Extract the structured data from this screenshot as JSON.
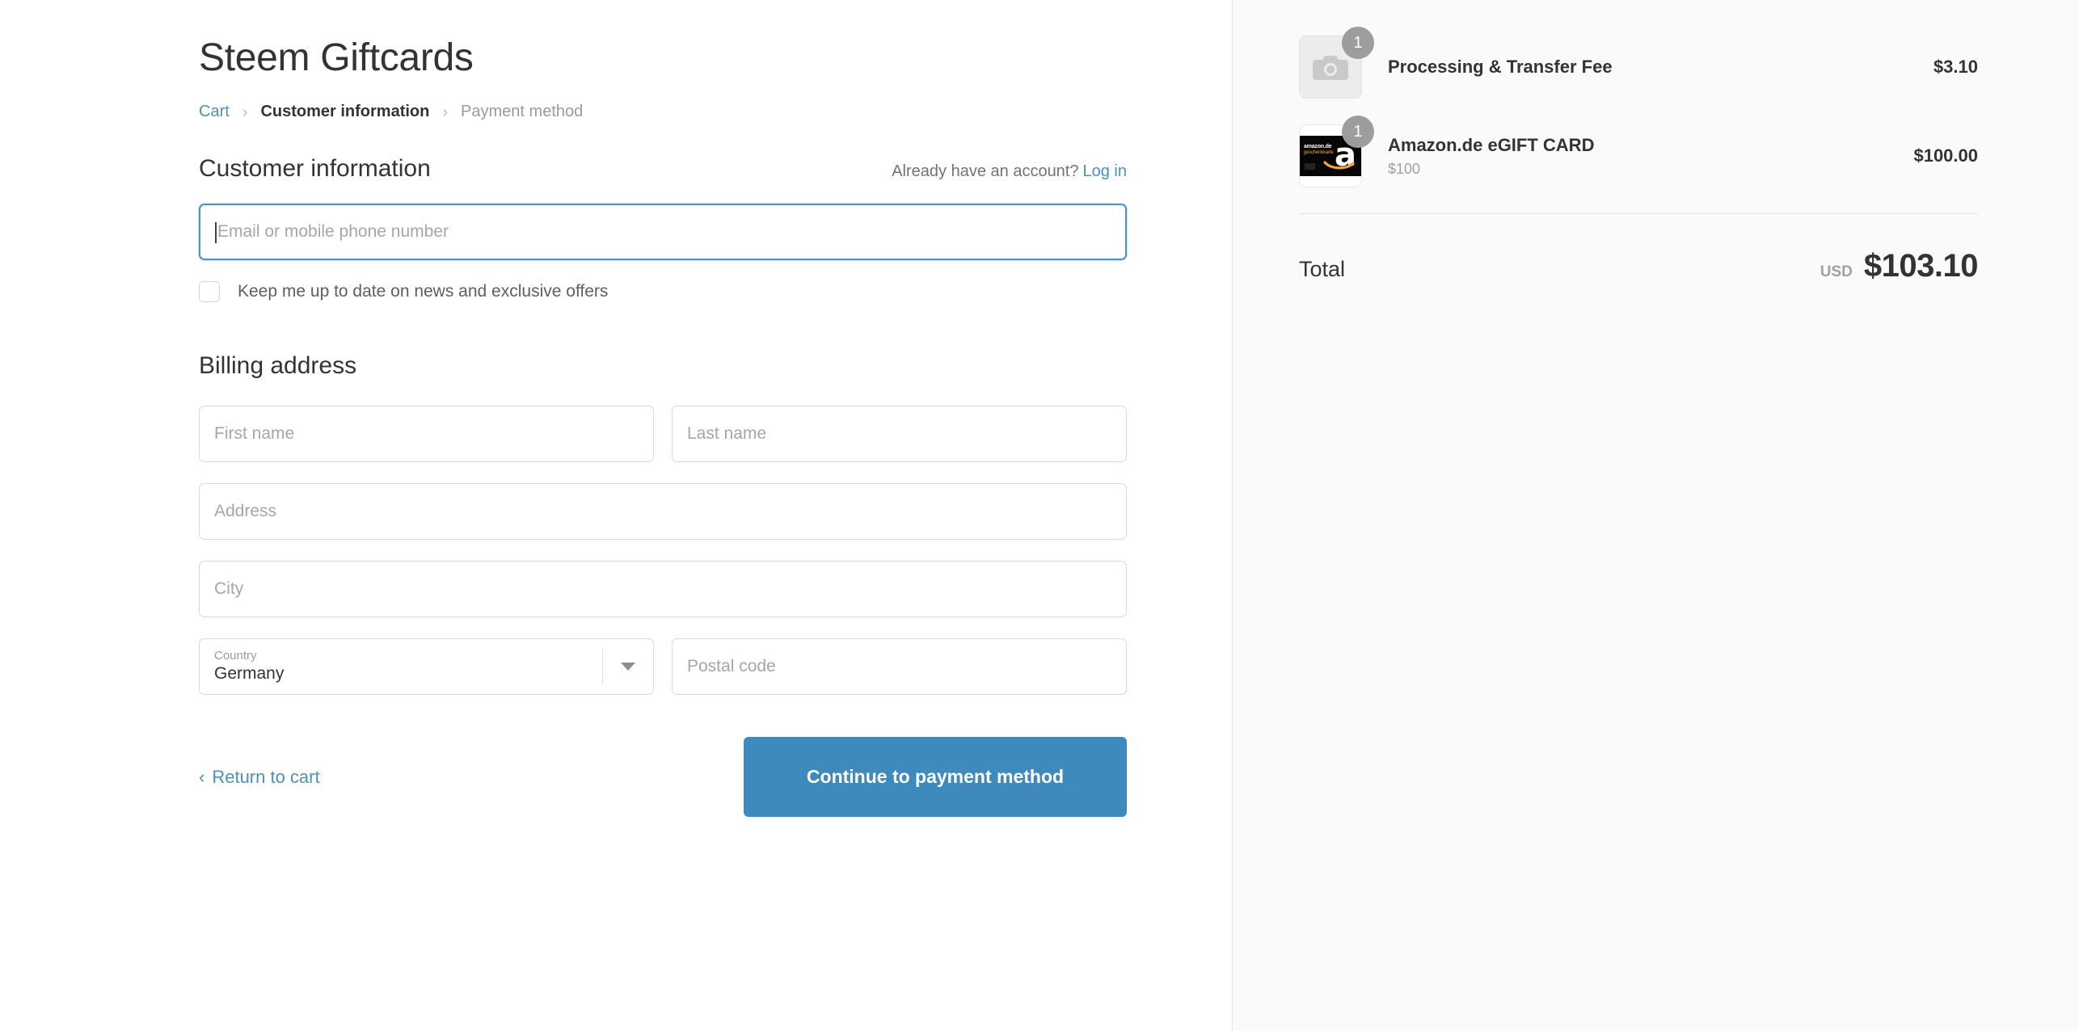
{
  "shop": {
    "title": "Steem Giftcards"
  },
  "breadcrumb": {
    "items": [
      {
        "label": "Cart",
        "state": "link"
      },
      {
        "label": "Customer information",
        "state": "current"
      },
      {
        "label": "Payment method",
        "state": "muted"
      }
    ],
    "separator": "›"
  },
  "customer_section": {
    "title": "Customer information",
    "account_prompt": "Already have an account?",
    "login_label": "Log in",
    "email_placeholder": "Email or mobile phone number",
    "email_value": "",
    "newsletter_label": "Keep me up to date on news and exclusive offers",
    "newsletter_checked": false
  },
  "billing_section": {
    "title": "Billing address",
    "first_name_placeholder": "First name",
    "first_name_value": "",
    "last_name_placeholder": "Last name",
    "last_name_value": "",
    "address_placeholder": "Address",
    "address_value": "",
    "city_placeholder": "City",
    "city_value": "",
    "country_label": "Country",
    "country_value": "Germany",
    "postal_placeholder": "Postal code",
    "postal_value": ""
  },
  "actions": {
    "return_label": "Return to cart",
    "return_chevron": "‹",
    "continue_label": "Continue to payment method"
  },
  "order_summary": {
    "items": [
      {
        "name": "Processing & Transfer Fee",
        "variant": "",
        "price": "$3.10",
        "quantity": "1",
        "thumb": "camera-placeholder-icon"
      },
      {
        "name": "Amazon.de eGIFT CARD",
        "variant": "$100",
        "price": "$100.00",
        "quantity": "1",
        "thumb": "amazon-giftcard-image"
      }
    ],
    "giftcard_art": {
      "brand_line1": "amazon.de",
      "brand_line2": "geschenkkarte",
      "letter": "a"
    },
    "total_label": "Total",
    "total_currency": "USD",
    "total_value": "$103.10"
  },
  "colors": {
    "link_blue": "#4c90c0",
    "button_blue": "#3f8abd",
    "focus_blue": "#4b94c4",
    "sidebar_bg": "#fafafa",
    "badge_gray": "#9d9d9d"
  }
}
